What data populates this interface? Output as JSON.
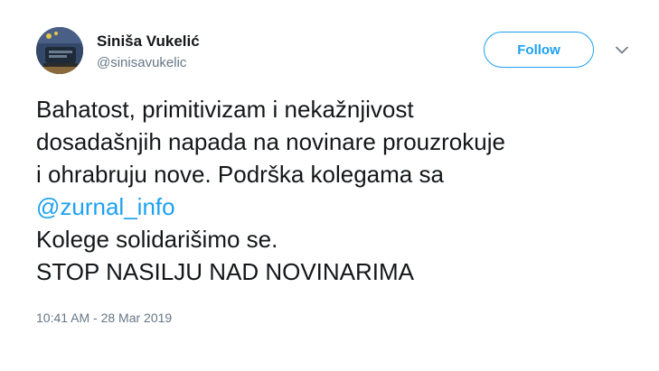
{
  "author": {
    "name": "Siniša Vukelić",
    "handle": "@sinisavukelic"
  },
  "follow_button": {
    "label": "Follow"
  },
  "tweet": {
    "line1": "Bahatost, primitivizam i nekažnjivost",
    "line2": "dosadašnjih napada na novinare prouzrokuje",
    "line3": "i ohrabruju nove.  Podrška kolegama sa",
    "mention": "@zurnal_info",
    "line5": "Kolege solidarišimo se.",
    "line6": "STOP NASILJU NAD NOVINARIMA"
  },
  "timestamp": "10:41 AM - 28 Mar 2019",
  "colors": {
    "accent": "#1da1f2",
    "text": "#14171a",
    "secondary": "#657786"
  },
  "icons": {
    "caret": "chevron-down-icon"
  }
}
